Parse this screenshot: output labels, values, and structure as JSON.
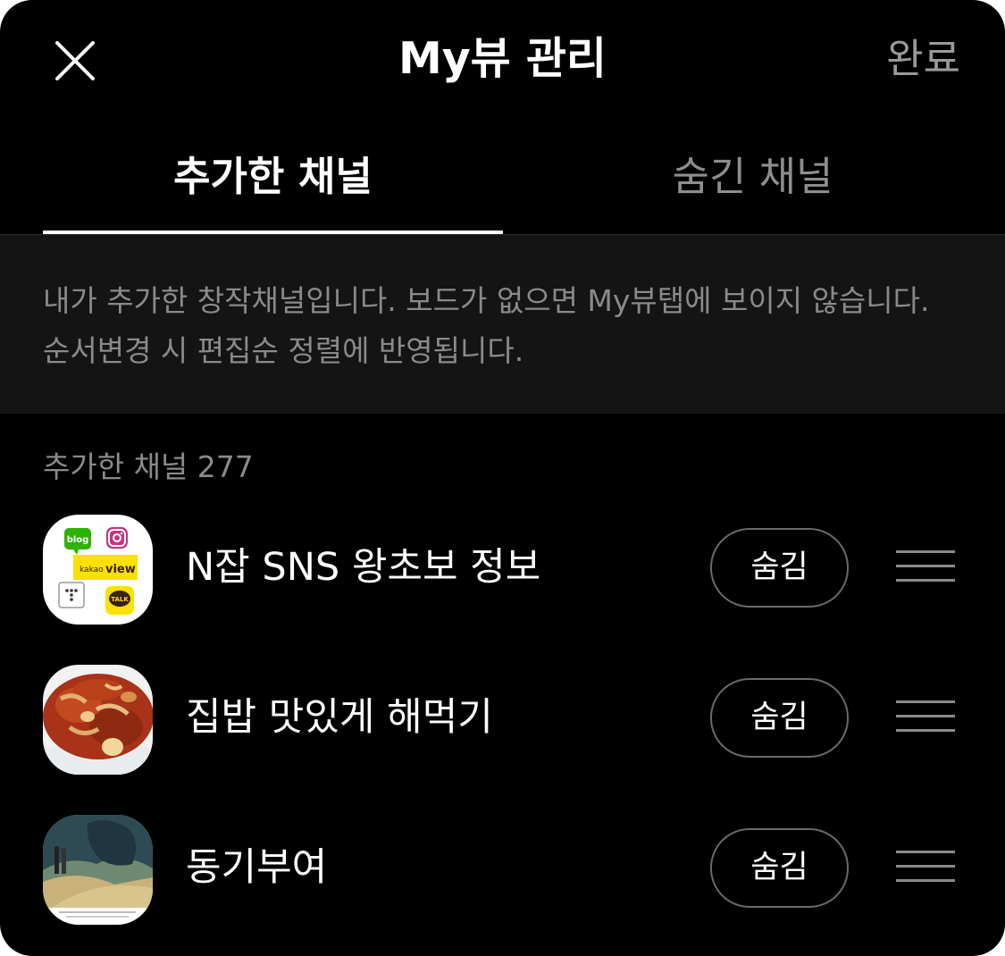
{
  "header": {
    "title": "My뷰 관리",
    "done_label": "완료"
  },
  "tabs": [
    {
      "label": "추가한 채널",
      "selected": true
    },
    {
      "label": "숨긴 채널",
      "selected": false
    }
  ],
  "notice": {
    "text": "내가 추가한 창작채널입니다. 보드가 없으면 My뷰탭에 보이지 않습니다. 순서변경 시 편집순 정렬에 반영됩니다."
  },
  "channel_list": {
    "count_label": "추가한 채널 277",
    "items": [
      {
        "name": "N잡 SNS 왕초보 정보",
        "hide_label": "숨김",
        "thumbnail": "sns-app-icons"
      },
      {
        "name": "집밥 맛있게 해먹기",
        "hide_label": "숨김",
        "thumbnail": "stir-fried-food"
      },
      {
        "name": "동기부여",
        "hide_label": "숨김",
        "thumbnail": "painting-trees-path"
      }
    ]
  },
  "thumbnail_texts": {
    "blog": "blog",
    "kakao": "kakao",
    "view": "view",
    "talk": "TALK"
  },
  "colors": {
    "background": "#000000",
    "notice_background": "#141414",
    "primary_text": "#ffffff",
    "secondary_text": "#8a8a8a",
    "kakao_yellow": "#fae100"
  }
}
